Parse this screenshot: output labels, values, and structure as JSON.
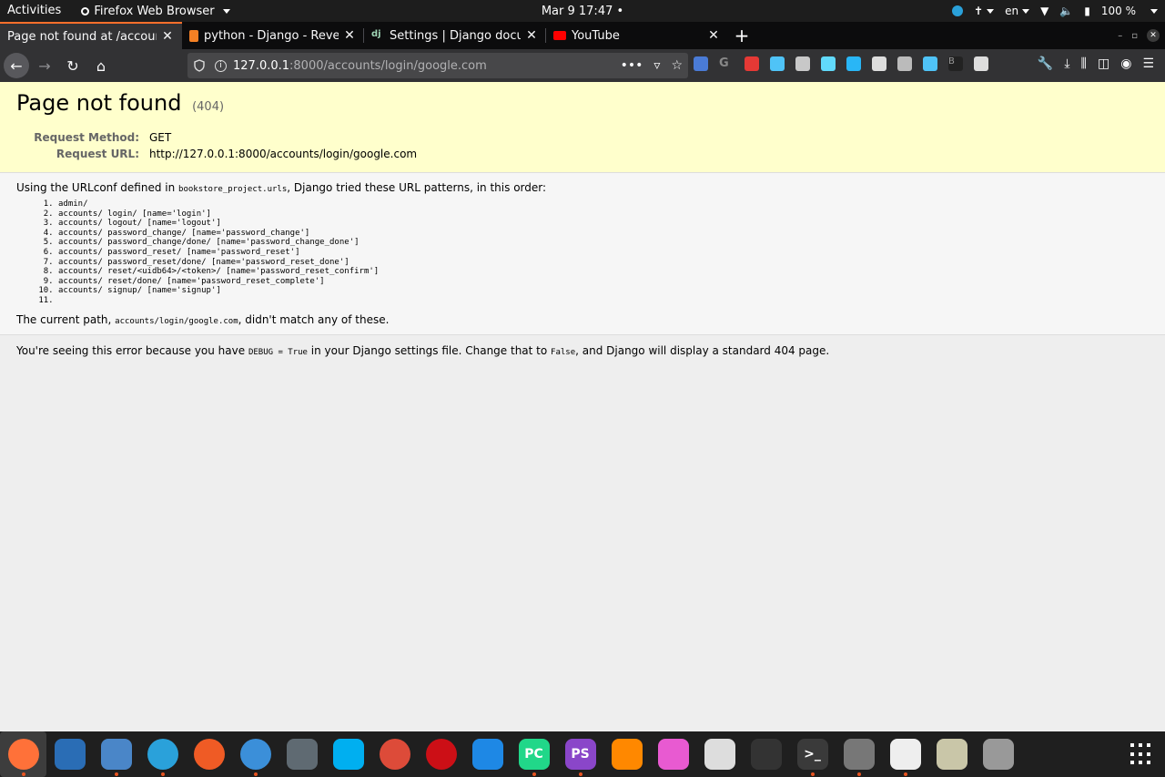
{
  "topbar": {
    "activities": "Activities",
    "app_name": "Firefox Web Browser",
    "clock": "Mar 9  17:47",
    "language": "en",
    "battery": "100 %"
  },
  "tabs": [
    {
      "title": "Page not found at /accounts",
      "active": true,
      "favicon_color": "#ffffff"
    },
    {
      "title": "python - Django - Reverse",
      "active": false,
      "favicon_color": "#f48024"
    },
    {
      "title": "Settings | Django docum",
      "active": false,
      "favicon_color": "#0c4b33"
    },
    {
      "title": "YouTube",
      "active": false,
      "favicon_color": "#ff0000"
    }
  ],
  "url": {
    "host": "127.0.0.1",
    "rest": ":8000/accounts/login/google.com"
  },
  "page": {
    "title": "Page not found",
    "code": "(404)",
    "request_method_label": "Request Method:",
    "request_method": "GET",
    "request_url_label": "Request URL:",
    "request_url": "http://127.0.0.1:8000/accounts/login/google.com",
    "urlconf_prefix": "Using the URLconf defined in ",
    "urlconf_module": "bookstore_project.urls",
    "urlconf_suffix": ", Django tried these URL patterns, in this order:",
    "patterns": [
      "admin/",
      "accounts/ login/ [name='login']",
      "accounts/ logout/ [name='logout']",
      "accounts/ password_change/ [name='password_change']",
      "accounts/ password_change/done/ [name='password_change_done']",
      "accounts/ password_reset/ [name='password_reset']",
      "accounts/ password_reset/done/ [name='password_reset_done']",
      "accounts/ reset/<uidb64>/<token>/ [name='password_reset_confirm']",
      "accounts/ reset/done/ [name='password_reset_complete']",
      "accounts/ signup/ [name='signup']",
      ""
    ],
    "current_path_prefix": "The current path, ",
    "current_path": "accounts/login/google.com",
    "current_path_suffix": ", didn't match any of these.",
    "explanation_1": "You're seeing this error because you have ",
    "debug_code": "DEBUG = True",
    "explanation_2": " in your Django settings file. Change that to ",
    "false_code": "False",
    "explanation_3": ", and Django will display a standard 404 page."
  },
  "extensions": [
    {
      "name": "translate-icon",
      "color": "#4a7bd6"
    },
    {
      "name": "google-icon",
      "color": "#888888"
    },
    {
      "name": "screenshot-icon",
      "color": "#e53935"
    },
    {
      "name": "gem-icon",
      "color": "#4fc3f7"
    },
    {
      "name": "vue-icon",
      "color": "#c8c8c8"
    },
    {
      "name": "react-icon",
      "color": "#61dafb"
    },
    {
      "name": "network-icon",
      "color": "#29b6f6"
    },
    {
      "name": "s-icon",
      "color": "#dddddd"
    },
    {
      "name": "mail-icon",
      "color": "#bbbbbb"
    },
    {
      "name": "dropbox-icon",
      "color": "#4fc3f7"
    },
    {
      "name": "b-icon",
      "color": "#222222"
    },
    {
      "name": "paw-icon",
      "color": "#dddddd"
    }
  ],
  "dock": [
    {
      "name": "dock-firefox",
      "color": "#ff7139",
      "label": "",
      "running": true,
      "active": true
    },
    {
      "name": "dock-thunderbird",
      "color": "#2a6db5",
      "label": "",
      "running": false
    },
    {
      "name": "dock-files",
      "color": "#4a86c8",
      "label": "",
      "running": true
    },
    {
      "name": "dock-telegram",
      "color": "#2aa1da",
      "label": "",
      "running": true
    },
    {
      "name": "dock-postman",
      "color": "#ef5b25",
      "label": "",
      "running": false
    },
    {
      "name": "dock-simplenote",
      "color": "#3b8fd9",
      "label": "",
      "running": true
    },
    {
      "name": "dock-settings",
      "color": "#5f6a72",
      "label": "",
      "running": false
    },
    {
      "name": "dock-skype",
      "color": "#00aff0",
      "label": "",
      "running": false
    },
    {
      "name": "dock-chrome",
      "color": "#dd4b39",
      "label": "",
      "running": false
    },
    {
      "name": "dock-opera",
      "color": "#cc0f16",
      "label": "",
      "running": false
    },
    {
      "name": "dock-vscode",
      "color": "#1e88e5",
      "label": "",
      "running": false
    },
    {
      "name": "dock-pycharm",
      "color": "#21d789",
      "label": "PC",
      "running": true
    },
    {
      "name": "dock-phpstorm",
      "color": "#8a46c9",
      "label": "PS",
      "running": true
    },
    {
      "name": "dock-vlc",
      "color": "#ff8800",
      "label": "",
      "running": false
    },
    {
      "name": "dock-gem",
      "color": "#e85ad1",
      "label": "",
      "running": false
    },
    {
      "name": "dock-music",
      "color": "#dddddd",
      "label": "",
      "running": false
    },
    {
      "name": "dock-system-monitor",
      "color": "#333333",
      "label": "",
      "running": false
    },
    {
      "name": "dock-terminal",
      "color": "#3a3a3a",
      "label": ">_",
      "running": true
    },
    {
      "name": "dock-help",
      "color": "#777777",
      "label": "",
      "running": true
    },
    {
      "name": "dock-image-viewer",
      "color": "#eeeeee",
      "label": "",
      "running": true
    },
    {
      "name": "dock-notes",
      "color": "#c9c6a8",
      "label": "",
      "running": false
    },
    {
      "name": "dock-usb",
      "color": "#999999",
      "label": "",
      "running": false
    }
  ]
}
